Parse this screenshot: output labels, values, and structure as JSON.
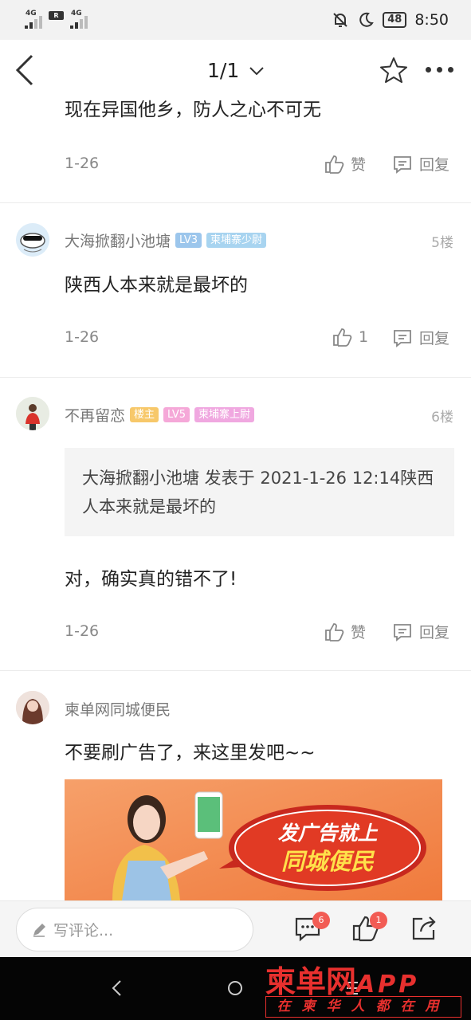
{
  "status_bar": {
    "sim1": "4G",
    "sim2": "4G",
    "roaming": "R",
    "battery": "48",
    "time": "8:50"
  },
  "nav": {
    "page_indicator": "1/1"
  },
  "clipped_comment": {
    "text": "现在异国他乡，防人之心不可无",
    "date": "1-26",
    "like_label": "赞",
    "reply_label": "回复"
  },
  "comments": [
    {
      "username": "大海掀翻小池塘",
      "level": "LV3",
      "title": "柬埔寨少尉",
      "floor": "5楼",
      "text": "陕西人本来就是最坏的",
      "date": "1-26",
      "like_count": "1",
      "reply_label": "回复"
    },
    {
      "username": "不再留恋",
      "op_badge": "楼主",
      "level": "LV5",
      "title": "柬埔寨上尉",
      "floor": "6楼",
      "quote": "大海掀翻小池塘 发表于 2021-1-26 12:14陕西人本来就是最坏的",
      "text": "对，确实真的错不了!",
      "date": "1-26",
      "like_label": "赞",
      "reply_label": "回复"
    },
    {
      "username": "柬单网同城便民",
      "text": "不要刷广告了，来这里发吧~~",
      "ad": {
        "line1": "发广告就上",
        "line2": "同城便民"
      }
    }
  ],
  "bottom_bar": {
    "comment_placeholder": "写评论...",
    "comment_count": "6",
    "like_count": "1"
  },
  "watermark": {
    "brand": "柬单网",
    "app": "APP",
    "slogan": "在柬华人都在用"
  },
  "colors": {
    "lv3_badge": "#9cc6ec",
    "title_badge_blue": "#a8d4f0",
    "op_badge": "#f7c86a",
    "lv5_badge": "#f5a8d8",
    "title_badge_pink": "#f0a8e0",
    "brand_red": "#e8302e",
    "notif_red": "#f25c54"
  }
}
